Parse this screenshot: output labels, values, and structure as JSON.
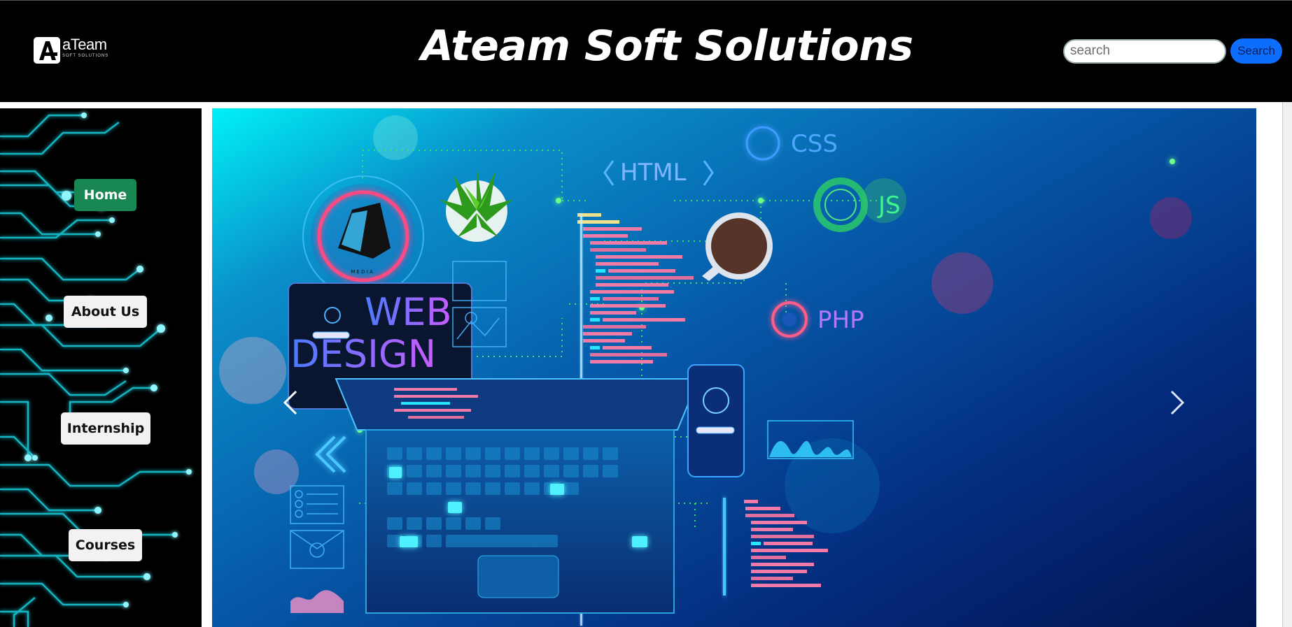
{
  "header": {
    "logo": {
      "name": "aTeam",
      "tagline": "SOFT SOLUTIONS"
    },
    "title": "Ateam Soft Solutions",
    "search": {
      "placeholder": "search",
      "button_label": "Search"
    }
  },
  "sidebar": {
    "items": [
      {
        "label": "Home",
        "active": true
      },
      {
        "label": "About Us",
        "active": false
      },
      {
        "label": "Internship",
        "active": false
      },
      {
        "label": "Courses",
        "active": false
      }
    ]
  },
  "carousel": {
    "labels": {
      "html": "HTML",
      "css": "CSS",
      "js": "JS",
      "php": "PHP",
      "web": "WEB",
      "design": "DESIGN",
      "media": "M E D I A"
    }
  },
  "colors": {
    "header_bg": "#000000",
    "active_nav": "#198754",
    "search_button": "#0d6efd",
    "nav_button": "#f4f1f2"
  }
}
